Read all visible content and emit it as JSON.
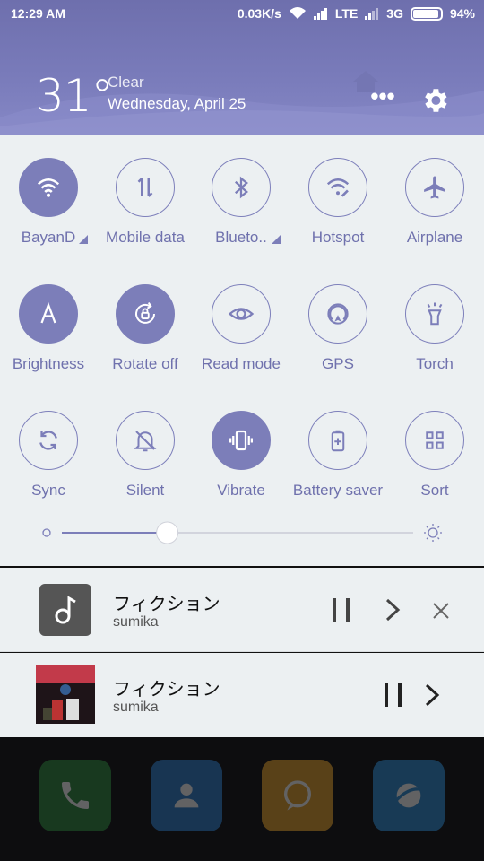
{
  "status_bar": {
    "time": "12:29 AM",
    "net_speed": "0.03K/s",
    "network1": "LTE",
    "network2": "3G",
    "battery": "94%",
    "battery_level": 0.94
  },
  "weather": {
    "temperature": "31°",
    "condition": "Clear",
    "date": "Wednesday, April 25"
  },
  "header_actions": {
    "more": "•••"
  },
  "toggles": [
    {
      "label": "BayanD",
      "icon": "wifi-icon",
      "on": true
    },
    {
      "label": "Mobile data",
      "icon": "mobile-data-icon",
      "on": false
    },
    {
      "label": "Blueto..",
      "icon": "bluetooth-icon",
      "on": false
    },
    {
      "label": "Hotspot",
      "icon": "hotspot-icon",
      "on": false
    },
    {
      "label": "Airplane",
      "icon": "airplane-icon",
      "on": false
    },
    {
      "label": "Brightness",
      "icon": "auto-brightness-icon",
      "on": true
    },
    {
      "label": "Rotate off",
      "icon": "rotation-lock-icon",
      "on": true
    },
    {
      "label": "Read mode",
      "icon": "eye-icon",
      "on": false
    },
    {
      "label": "GPS",
      "icon": "gps-icon",
      "on": false
    },
    {
      "label": "Torch",
      "icon": "torch-icon",
      "on": false
    },
    {
      "label": "Sync",
      "icon": "sync-icon",
      "on": false
    },
    {
      "label": "Silent",
      "icon": "bell-off-icon",
      "on": false
    },
    {
      "label": "Vibrate",
      "icon": "vibrate-icon",
      "on": true
    },
    {
      "label": "Battery saver",
      "icon": "battery-saver-icon",
      "on": false
    },
    {
      "label": "Sort",
      "icon": "grid-icon",
      "on": false
    }
  ],
  "brightness": {
    "level": 0.3
  },
  "notifications": [
    {
      "title": "フィクション",
      "subtitle": "sumika"
    },
    {
      "title": "フィクション",
      "subtitle": "sumika"
    }
  ],
  "colors": {
    "accent": "#7c7eb9",
    "panel_bg": "#ecf0f2",
    "header_bg": "#7576b5"
  }
}
